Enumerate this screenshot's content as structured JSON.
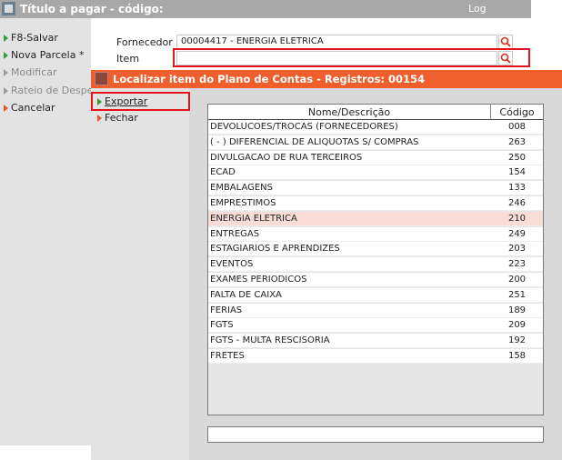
{
  "window": {
    "title": "Título a pagar - código:",
    "log_label": "Log"
  },
  "left_commands": [
    {
      "label": "F8-Salvar",
      "state": "enabled",
      "arrow": "green"
    },
    {
      "label": "Nova Parcela *",
      "state": "enabled",
      "arrow": "green"
    },
    {
      "label": "Modificar",
      "state": "disabled",
      "arrow": "gray"
    },
    {
      "label": "Rateio de Despesas",
      "state": "disabled",
      "arrow": "gray"
    },
    {
      "label": "Cancelar",
      "state": "enabled",
      "arrow": "orange"
    }
  ],
  "form": {
    "fornecedor_label": "Fornecedor",
    "fornecedor_value": "00004417 - ENERGIA ELETRICA",
    "item_label": "Item",
    "item_value": ""
  },
  "dialog": {
    "title": "Localizar item do Plano de Contas - Registros: 00154",
    "commands": [
      {
        "label": "Exportar",
        "arrow": "green"
      },
      {
        "label": "Fechar",
        "arrow": "orange"
      }
    ],
    "columns": [
      "Nome/Descrição",
      "Código"
    ],
    "rows": [
      {
        "name": "DEVOLUCOES/TROCAS (FORNECEDORES)",
        "code": "008"
      },
      {
        "name": "( - ) DIFERENCIAL DE ALIQUOTAS S/ COMPRAS",
        "code": "263"
      },
      {
        "name": "DIVULGACAO DE RUA TERCEIROS",
        "code": "250"
      },
      {
        "name": "ECAD",
        "code": "154"
      },
      {
        "name": "EMBALAGENS",
        "code": "133"
      },
      {
        "name": "EMPRESTIMOS",
        "code": "246"
      },
      {
        "name": "ENERGIA ELETRICA",
        "code": "210",
        "selected": true
      },
      {
        "name": "ENTREGAS",
        "code": "249"
      },
      {
        "name": "ESTAGIARIOS E APRENDIZES",
        "code": "203"
      },
      {
        "name": "EVENTOS",
        "code": "223"
      },
      {
        "name": "EXAMES PERIODICOS",
        "code": "200"
      },
      {
        "name": "FALTA DE CAIXA",
        "code": "251"
      },
      {
        "name": "FERIAS",
        "code": "189"
      },
      {
        "name": "FGTS",
        "code": "209"
      },
      {
        "name": "FGTS - MULTA RESCISORIA",
        "code": "192"
      },
      {
        "name": "FRETES",
        "code": "158"
      }
    ],
    "search_value": ""
  },
  "colors": {
    "dialog_title_bg": "#ee5f2d",
    "window_title_bg": "#a8a8a8",
    "selected_row_bg": "#fadcd6",
    "highlight_border": "#e3131b"
  },
  "icons": [
    "search-icon",
    "window-icon",
    "dialog-icon"
  ]
}
